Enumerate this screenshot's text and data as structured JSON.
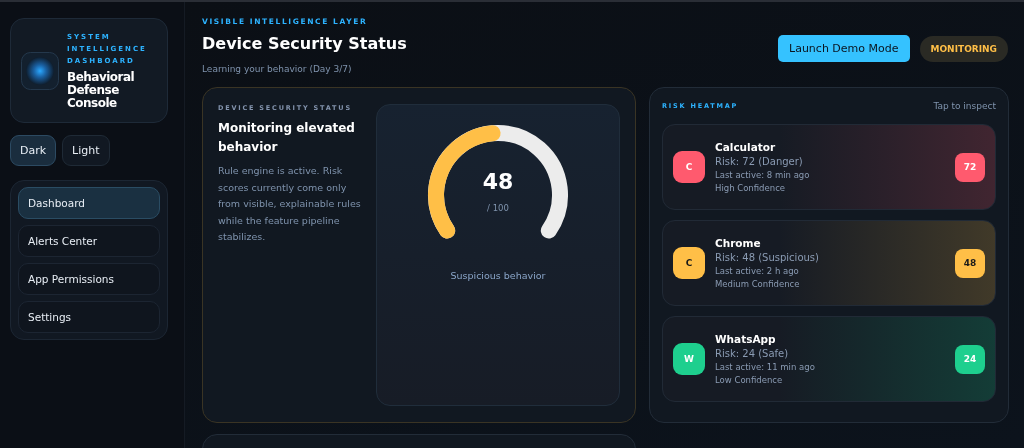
{
  "brand": {
    "eyebrow": "SYSTEM INTELLIGENCE DASHBOARD",
    "title": "Behavioral Defense Console"
  },
  "theme_toggle": [
    {
      "label": "Dark",
      "selected": true
    },
    {
      "label": "Light",
      "selected": false
    }
  ],
  "nav": [
    {
      "label": "Dashboard",
      "selected": true
    },
    {
      "label": "Alerts Center",
      "selected": false
    },
    {
      "label": "App Permissions",
      "selected": false
    },
    {
      "label": "Settings",
      "selected": false
    }
  ],
  "header": {
    "eyebrow": "VISIBLE INTELLIGENCE LAYER",
    "title": "Device Security Status",
    "subtitle": "Learning your behavior (Day 3/7)",
    "action": "Launch Demo Mode",
    "status": "MONITORING"
  },
  "status_card": {
    "eyebrow": "DEVICE SECURITY STATUS",
    "title": "Monitoring elevated behavior",
    "body": "Rule engine is active. Risk scores currently come only from visible, explainable rules while the feature pipeline stabilizes.",
    "gauge": {
      "level": 0.48,
      "score": "48",
      "max": "/ 100",
      "caption": "Suspicious behavior"
    }
  },
  "heatmap": {
    "title": "RISK HEATMAP",
    "hint": "Tap to inspect",
    "apps": [
      {
        "initial": "C",
        "name": "Calculator",
        "risk": "Risk: 72 (Danger)",
        "last_active": "Last active: 8 min ago",
        "confidence": "High Confidence",
        "score": "72",
        "color": "#ff5a6e"
      },
      {
        "initial": "C",
        "name": "Chrome",
        "risk": "Risk: 48 (Suspicious)",
        "last_active": "Last active: 2 h ago",
        "confidence": "Medium Confidence",
        "score": "48",
        "color": "#ffbf47"
      },
      {
        "initial": "W",
        "name": "WhatsApp",
        "risk": "Risk: 24 (Safe)",
        "last_active": "Last active: 11 min ago",
        "confidence": "Low Confidence",
        "score": "24",
        "color": "#1ecf8e"
      }
    ]
  }
}
